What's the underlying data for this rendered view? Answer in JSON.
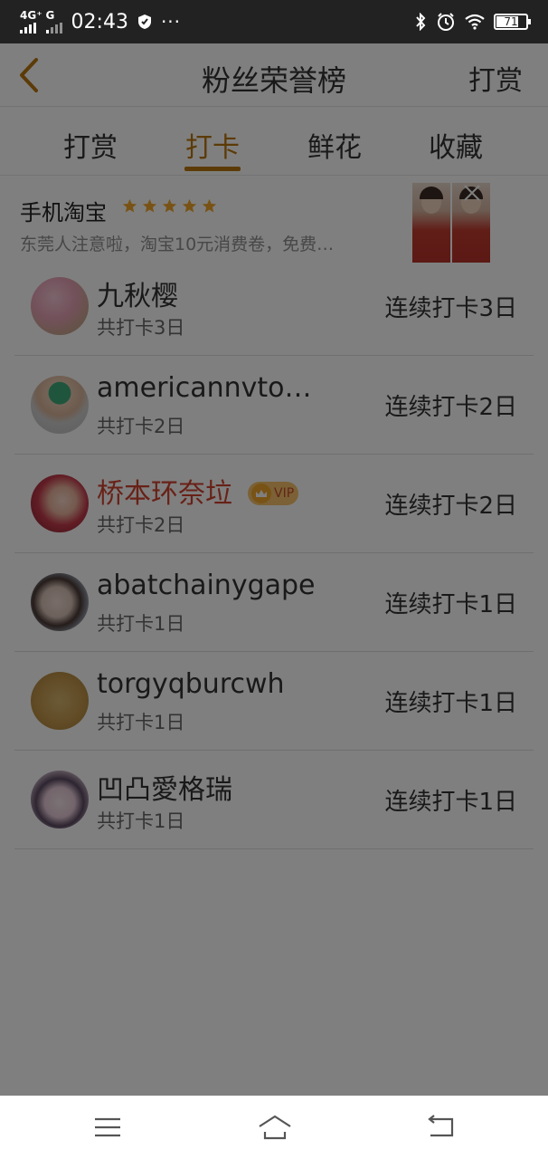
{
  "status_bar": {
    "network": "4G⁺",
    "network2": "G",
    "time": "02:43",
    "more": "···",
    "battery": "71"
  },
  "header": {
    "title": "粉丝荣誉榜",
    "action": "打赏"
  },
  "tabs": [
    {
      "label": "打赏",
      "active": false
    },
    {
      "label": "打卡",
      "active": true
    },
    {
      "label": "鲜花",
      "active": false
    },
    {
      "label": "收藏",
      "active": false
    }
  ],
  "ad": {
    "title": "手机淘宝",
    "rating": 5,
    "description": "东莞人注意啦，淘宝10元消费卷，免费…"
  },
  "fans": [
    {
      "name": "九秋樱",
      "total": "共打卡3日",
      "streak": "连续打卡3日",
      "vip": false
    },
    {
      "name": "americannvto…",
      "total": "共打卡2日",
      "streak": "连续打卡2日",
      "vip": false
    },
    {
      "name": "桥本环奈垃",
      "total": "共打卡2日",
      "streak": "连续打卡2日",
      "vip": true,
      "vip_label": "VIP"
    },
    {
      "name": "abatchainygape",
      "total": "共打卡1日",
      "streak": "连续打卡1日",
      "vip": false
    },
    {
      "name": "torgyqburcwh",
      "total": "共打卡1日",
      "streak": "连续打卡1日",
      "vip": false
    },
    {
      "name": "凹凸愛格瑞",
      "total": "共打卡1日",
      "streak": "连续打卡1日",
      "vip": false
    }
  ],
  "colors": {
    "accent": "#b8760f",
    "vip_name": "#d0432e",
    "status_bar_bg": "#222222"
  }
}
